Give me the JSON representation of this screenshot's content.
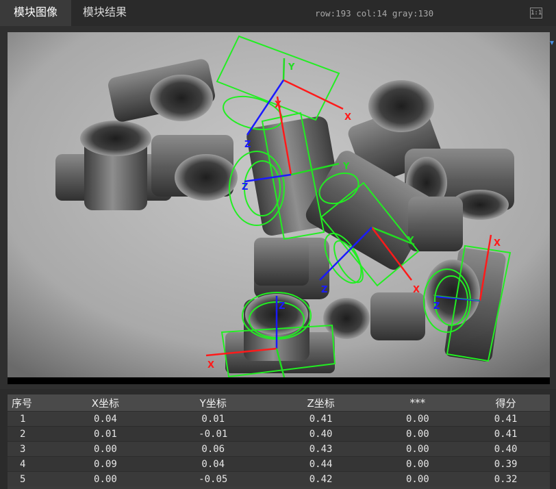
{
  "tabs": [
    {
      "label": "模块图像",
      "active": true
    },
    {
      "label": "模块结果",
      "active": false
    }
  ],
  "status": "row:193 col:14 gray:130",
  "fit_button": "1:1",
  "axes_labels": {
    "x": "X",
    "y": "Y",
    "z": "Z"
  },
  "colors": {
    "x_axis": "#ff1a1a",
    "y_axis": "#22dd22",
    "z_axis": "#1a1aff",
    "outline": "#22ee22"
  },
  "table": {
    "headers": [
      "序号",
      "X坐标",
      "Y坐标",
      "Z坐标",
      "***",
      "得分"
    ],
    "rows": [
      [
        "1",
        "0.04",
        "0.01",
        "0.41",
        "0.00",
        "0.41"
      ],
      [
        "2",
        "0.01",
        "-0.01",
        "0.40",
        "0.00",
        "0.41"
      ],
      [
        "3",
        "0.00",
        "0.06",
        "0.43",
        "0.00",
        "0.40"
      ],
      [
        "4",
        "0.09",
        "0.04",
        "0.44",
        "0.00",
        "0.39"
      ],
      [
        "5",
        "0.00",
        "-0.05",
        "0.42",
        "0.00",
        "0.32"
      ]
    ]
  }
}
